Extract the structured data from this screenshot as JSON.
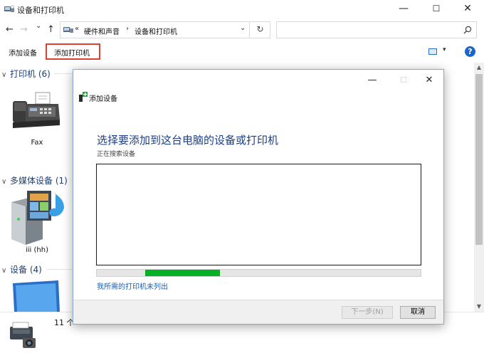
{
  "window": {
    "title": "设备和打印机",
    "controls": {
      "minimize": "—",
      "maximize": "☐",
      "close": "✕"
    }
  },
  "nav": {
    "back": "←",
    "forward": "→",
    "recent": "⌄",
    "up": "↑",
    "overflow": "«",
    "breadcrumb": [
      "硬件和声音",
      "设备和打印机"
    ],
    "separator": "›",
    "refresh": "↻"
  },
  "search": {
    "placeholder": "",
    "icon": "search-icon"
  },
  "commands": {
    "add_device": "添加设备",
    "add_printer": "添加打印机",
    "view_dropdown": "▾",
    "help": "?"
  },
  "groups": [
    {
      "chevron": "∨",
      "title": "打印机 (6)",
      "items": [
        {
          "label": "Fax",
          "icon": "fax-icon"
        }
      ]
    },
    {
      "chevron": "∨",
      "title": "多媒体设备 (1)",
      "items": [
        {
          "label": "iii (hh)",
          "icon": "media-device-icon"
        }
      ]
    },
    {
      "chevron": "∨",
      "title": "设备 (4)",
      "items": [
        {
          "label": "",
          "icon": "monitor-icon"
        }
      ]
    }
  ],
  "scrollbar": {
    "up": "▲",
    "down": "▼"
  },
  "details": {
    "count": "11 个"
  },
  "dialog": {
    "title": "添加设备",
    "controls": {
      "minimize": "—",
      "maximize": "☐",
      "close": "✕"
    },
    "heading": "选择要添加到这台电脑的设备或打印机",
    "status": "正在搜索设备",
    "progress": {
      "start": 0.15,
      "end": 0.38
    },
    "missing_link": "我所需的打印机未列出",
    "next_button": "下一步(N)",
    "cancel_button": "取消"
  },
  "colors": {
    "accent": "#1a66c9",
    "heading": "#1b3f87",
    "group_header": "#1e3f72",
    "progress": "#06b025",
    "highlight_box": "#e04030"
  }
}
